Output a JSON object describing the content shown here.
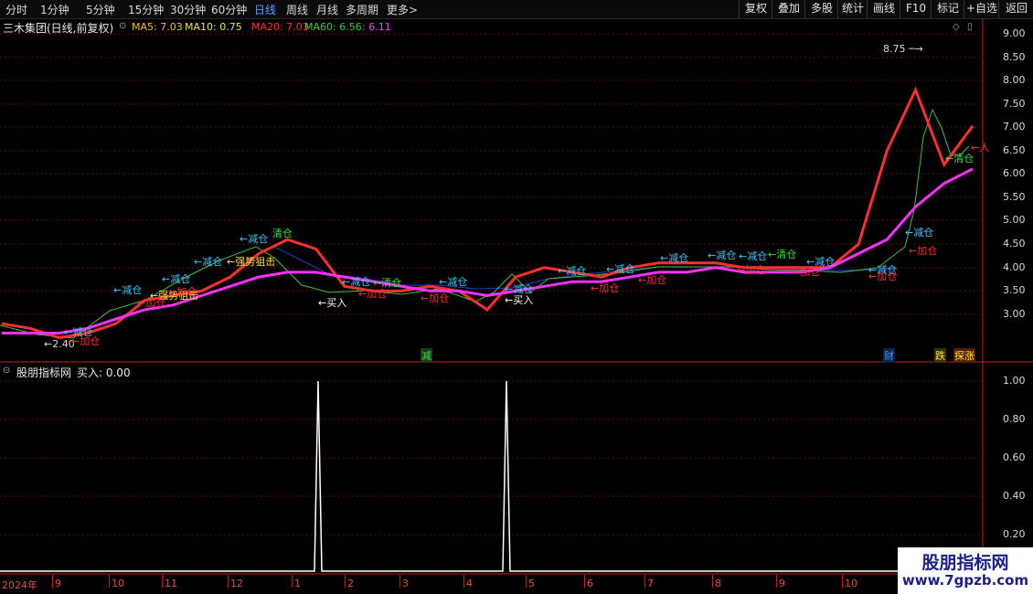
{
  "toolbar": {
    "periods": [
      "分时",
      "1分钟",
      "5分钟",
      "15分钟",
      "30分钟",
      "60分钟",
      "日线",
      "周线",
      "月线",
      "多周期",
      "更多"
    ],
    "active_period": "日线",
    "more_arrow": ">",
    "right_buttons": [
      "复权",
      "叠加",
      "多股",
      "统计",
      "画线",
      "F10",
      "标记",
      "+自选",
      "返回"
    ]
  },
  "main_header": {
    "title": "三木集团(日线,前复权)",
    "ma5": "MA5: 7.03",
    "ma10": "MA10: 0.75",
    "ma20": "MA20: 7.03",
    "ma60": "MA60: 6.56",
    "extra": ": 6.11",
    "colors": {
      "ma5": "#f0c020",
      "ma10": "#f0e040",
      "ma20": "#ff3030",
      "ma60": "#30d030",
      "extra": "#ff40ff"
    }
  },
  "price_axis": [
    "9.00",
    "8.50",
    "8.00",
    "7.50",
    "7.00",
    "6.50",
    "6.00",
    "5.50",
    "5.00",
    "4.50",
    "4.00",
    "3.50",
    "3.00"
  ],
  "price_range": [
    2.5,
    9.2
  ],
  "annotations": {
    "high": "8.75",
    "low": "2.40",
    "signals": [
      {
        "text": "←减仓",
        "color": "#40c8ff"
      },
      {
        "text": "←加仓",
        "color": "#ff3030"
      },
      {
        "text": "←减仓",
        "color": "#40c8ff"
      },
      {
        "text": "←加仓",
        "color": "#ff3030"
      },
      {
        "text": "←强势狙击",
        "color": "#ffe040"
      },
      {
        "text": "←减仓",
        "color": "#40c8ff"
      },
      {
        "text": "←加仓",
        "color": "#ff3030"
      },
      {
        "text": "←减仓",
        "color": "#40c8ff"
      },
      {
        "text": "←强势狙击",
        "color": "#ffe040"
      },
      {
        "text": "←减仓",
        "color": "#40c8ff"
      },
      {
        "text": "清仓",
        "color": "#40e040"
      },
      {
        "text": "←买入",
        "color": "#ffffff"
      },
      {
        "text": "←减仓",
        "color": "#40c8ff"
      },
      {
        "text": "←清仓",
        "color": "#40e040"
      },
      {
        "text": "←加仓",
        "color": "#ff3030"
      },
      {
        "text": "←减仓",
        "color": "#40c8ff"
      },
      {
        "text": "←加仓",
        "color": "#ff3030"
      },
      {
        "text": "←减仓",
        "color": "#40c8ff"
      },
      {
        "text": "←买入",
        "color": "#ffffff"
      },
      {
        "text": "←减仓",
        "color": "#40c8ff"
      },
      {
        "text": "←加仓",
        "color": "#ff3030"
      },
      {
        "text": "←减仓",
        "color": "#40c8ff"
      },
      {
        "text": "←加仓",
        "color": "#ff3030"
      },
      {
        "text": "←减仓",
        "color": "#40c8ff"
      },
      {
        "text": "←减仓",
        "color": "#40c8ff"
      },
      {
        "text": "←减仓",
        "color": "#40c8ff"
      },
      {
        "text": "←清仓",
        "color": "#40e040"
      },
      {
        "text": "←加仓",
        "color": "#ff3030"
      },
      {
        "text": "←减仓",
        "color": "#40c8ff"
      },
      {
        "text": "←加仓",
        "color": "#ff3030"
      },
      {
        "text": "←减仓",
        "color": "#40c8ff"
      },
      {
        "text": "←加仓",
        "color": "#ff3030"
      },
      {
        "text": "←减仓",
        "color": "#40c8ff"
      },
      {
        "text": "←加仓",
        "color": "#ff3030"
      },
      {
        "text": "←清仓",
        "color": "#40e040"
      },
      {
        "text": "←人",
        "color": "#ff3030"
      }
    ],
    "event_tags": [
      {
        "text": "减",
        "color": "#40e040",
        "bg": "#1a3a1a"
      },
      {
        "text": "财",
        "color": "#40a0ff",
        "bg": "#0a2050"
      },
      {
        "text": "跌",
        "color": "#ffe040",
        "bg": "#3a3000"
      },
      {
        "text": "探涨",
        "color": "#ffe040",
        "bg": "#502000"
      }
    ]
  },
  "sub_header": {
    "title": "股朋指标网",
    "value": "买入: 0.00"
  },
  "sub_axis": [
    "1.00",
    "0.80",
    "0.60",
    "0.40",
    "0.20"
  ],
  "date_axis": [
    "2024年",
    "9",
    "10",
    "11",
    "12",
    "1",
    "2",
    "3",
    "4",
    "5",
    "6",
    "7",
    "8",
    "9",
    "10"
  ],
  "watermark": {
    "title": "股朋指标网",
    "url": "www.7gpzb.com"
  },
  "chart_data": {
    "type": "line",
    "title": "三木集团(日线,前复权)",
    "price_axis_range": [
      2.5,
      9.2
    ],
    "series": [
      {
        "name": "MA5",
        "color": "#f0c020",
        "values": [
          2.8,
          2.7,
          2.5,
          2.6,
          2.8,
          3.3,
          3.4,
          3.5,
          3.8,
          4.3,
          4.6,
          4.4,
          3.6,
          3.5,
          3.5,
          3.6,
          3.5,
          3.1,
          3.8,
          4.0,
          3.9,
          3.8,
          4.0,
          4.1,
          4.1,
          4.1,
          4.0,
          4.0,
          4.0,
          4.0,
          4.5,
          6.5,
          7.8,
          6.2,
          7.03
        ]
      },
      {
        "name": "MA60",
        "color": "#ff40ff",
        "values": [
          2.6,
          2.6,
          2.6,
          2.7,
          2.9,
          3.1,
          3.2,
          3.4,
          3.6,
          3.8,
          3.9,
          3.9,
          3.8,
          3.7,
          3.6,
          3.5,
          3.5,
          3.4,
          3.5,
          3.6,
          3.7,
          3.7,
          3.8,
          3.9,
          3.9,
          4.0,
          3.9,
          3.9,
          3.9,
          4.0,
          4.3,
          4.6,
          5.3,
          5.8,
          6.11
        ]
      }
    ],
    "sub_indicator": {
      "name": "买入",
      "values_at_spikes": [
        1.0,
        1.0
      ],
      "current": 0.0
    }
  }
}
